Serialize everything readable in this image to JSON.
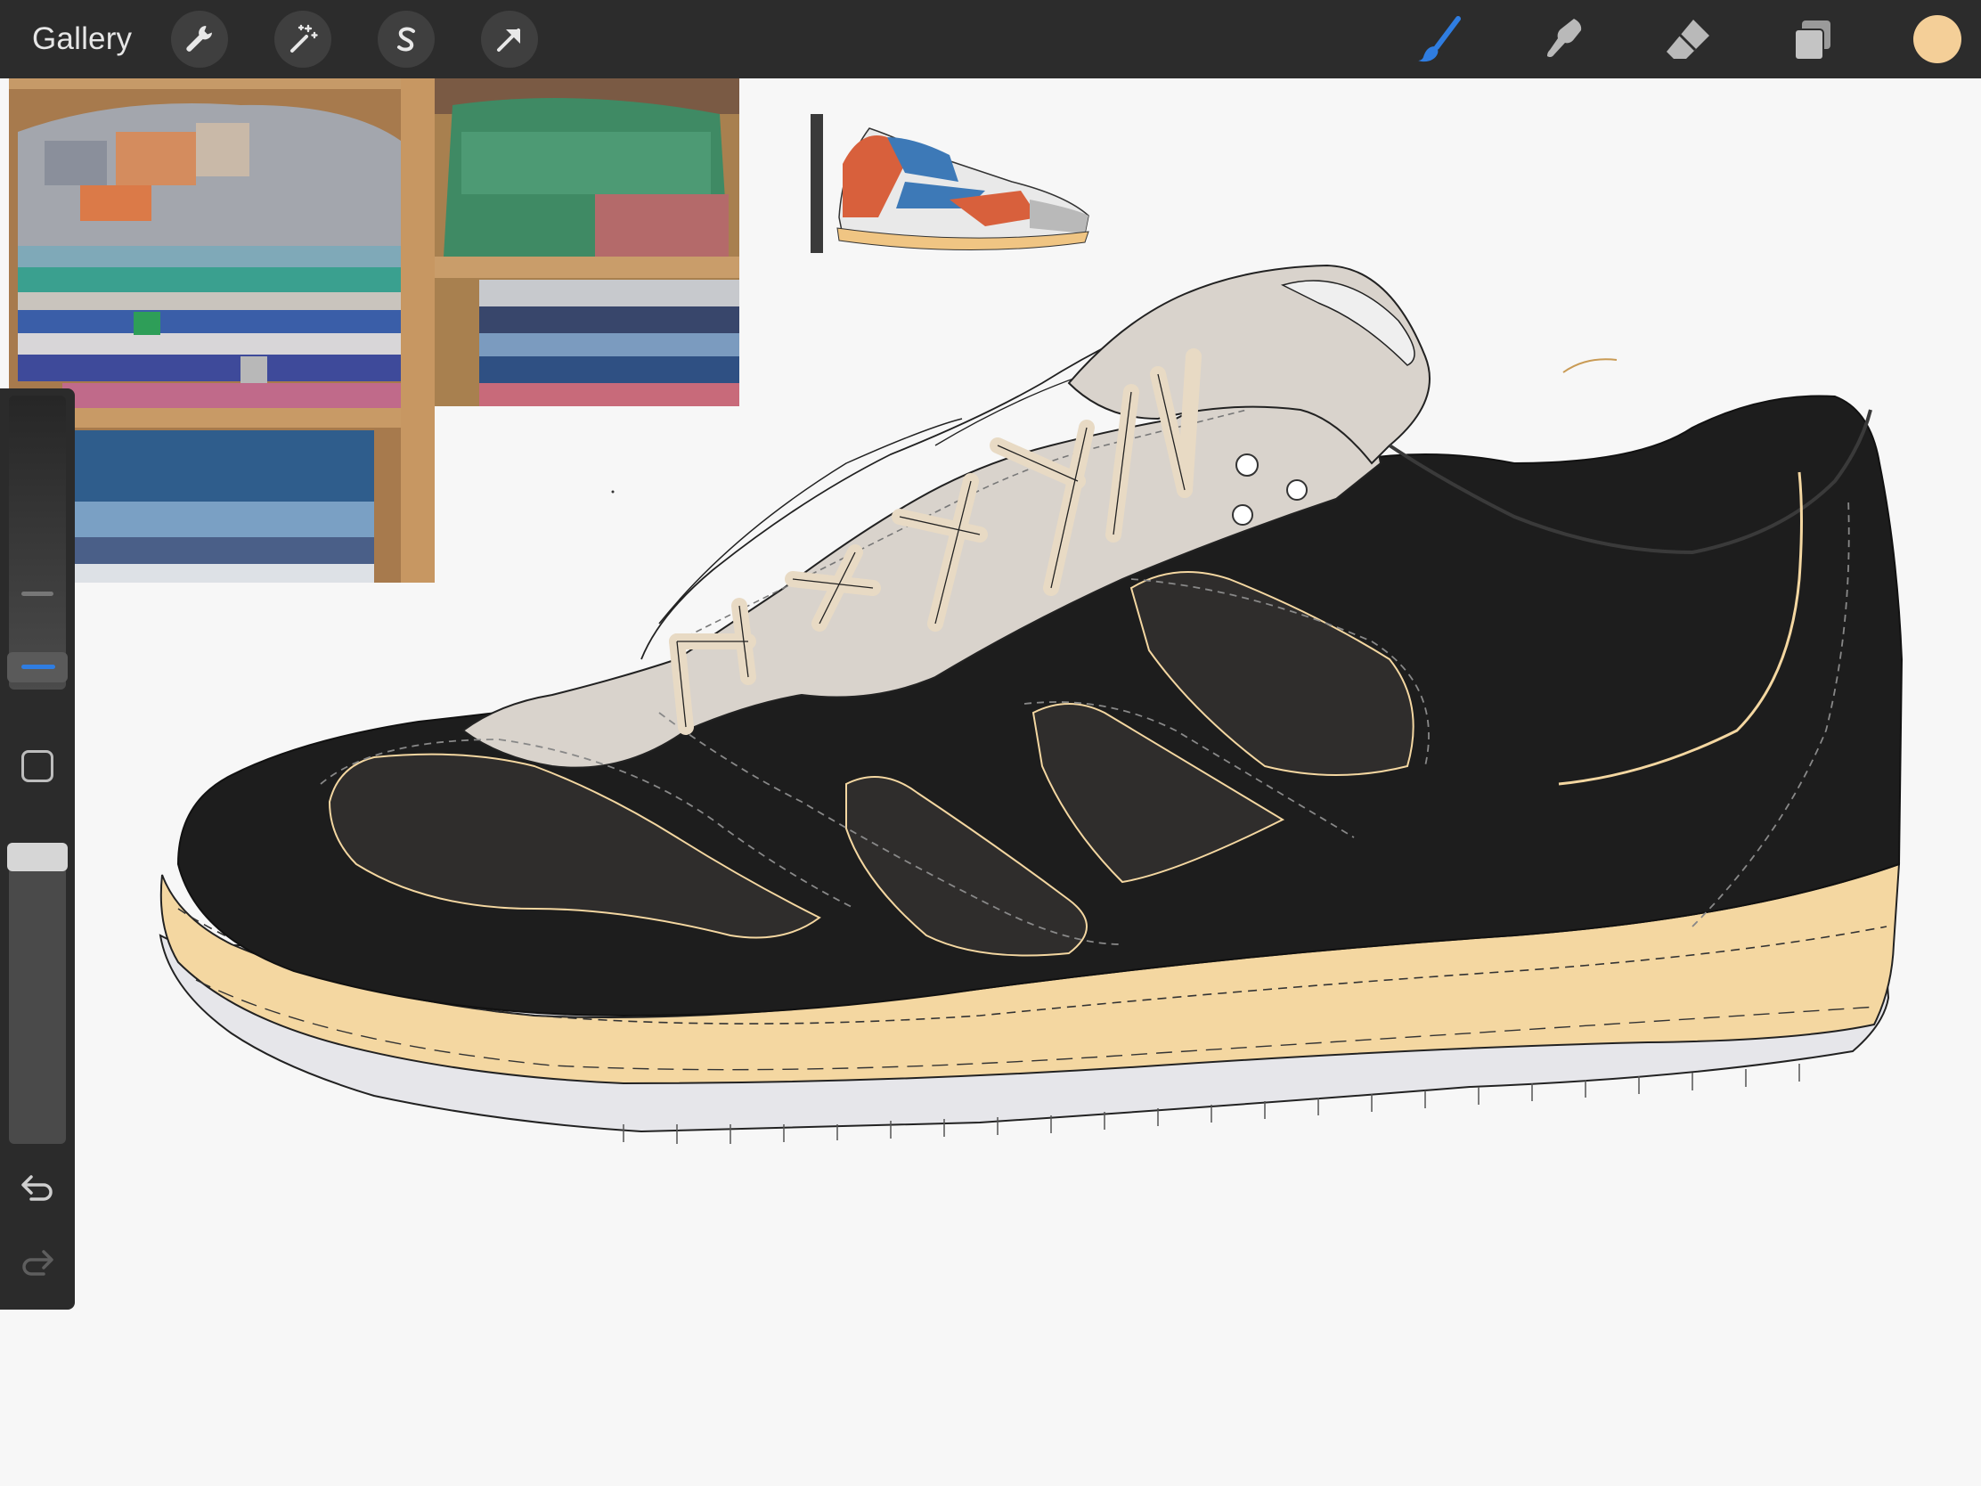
{
  "topbar": {
    "gallery_label": "Gallery",
    "left_tools": [
      "wrench-icon",
      "magic-wand-icon",
      "selection-icon",
      "transform-arrow-icon"
    ],
    "right_tools": [
      "brush-icon",
      "smudge-icon",
      "eraser-icon",
      "layers-icon"
    ],
    "active_tool": "brush",
    "current_color": "#f4cf98",
    "accent": "#2f7de1"
  },
  "sidebar": {
    "controls": [
      "brush-size-slider",
      "modify-button",
      "opacity-slider",
      "undo-icon",
      "redo-icon"
    ]
  },
  "canvas": {
    "references": [
      "folded-blankets-photo-left",
      "folded-blankets-photo-right",
      "sneaker-reference-thumbnail"
    ],
    "colors": {
      "upper": "#1d1d1d",
      "panel": "#2f2d2c",
      "toe_cap": "#d9d3cc",
      "midsole": "#f4d7a1",
      "outsole": "#e6e6e6",
      "laces": "#e8dac4"
    }
  }
}
